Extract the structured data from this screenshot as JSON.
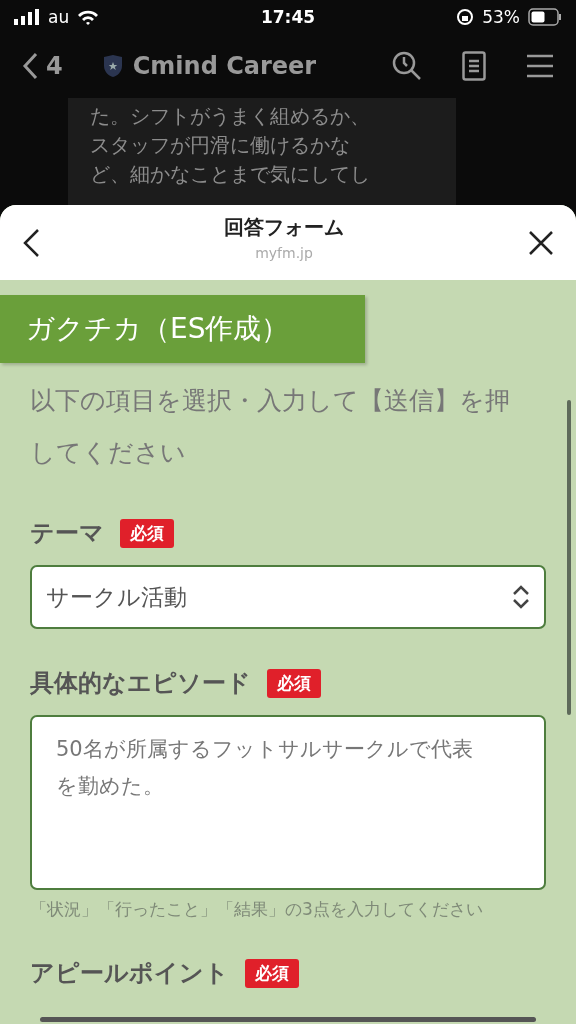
{
  "status_bar": {
    "carrier": "au",
    "time": "17:45",
    "battery": "53%"
  },
  "nav_bar": {
    "back_count": "4",
    "title": "Cmind Career"
  },
  "chat_bubble": {
    "lines": [
      "た。シフトがうまく組めるか、",
      "スタッフが円滑に働けるかな",
      "ど、細かなことまで気にしてし"
    ]
  },
  "sheet": {
    "title": "回答フォーム",
    "domain": "myfm.jp"
  },
  "form": {
    "heading": "ガクチカ（ES作成）",
    "instruction": "以下の項目を選択・入力して【送信】を押してください",
    "fields": [
      {
        "kind": "select",
        "label": "テーマ",
        "badge": "必須",
        "value": "サークル活動"
      },
      {
        "kind": "textarea",
        "label": "具体的なエピソード",
        "badge": "必須",
        "value": "50名が所属するフットサルサークルで代表を勤めた。",
        "hint": "「状況」「行ったこと」「結果」の3点を入力してください"
      },
      {
        "kind": "heading",
        "label": "アピールポイント",
        "badge": "必須"
      }
    ]
  }
}
